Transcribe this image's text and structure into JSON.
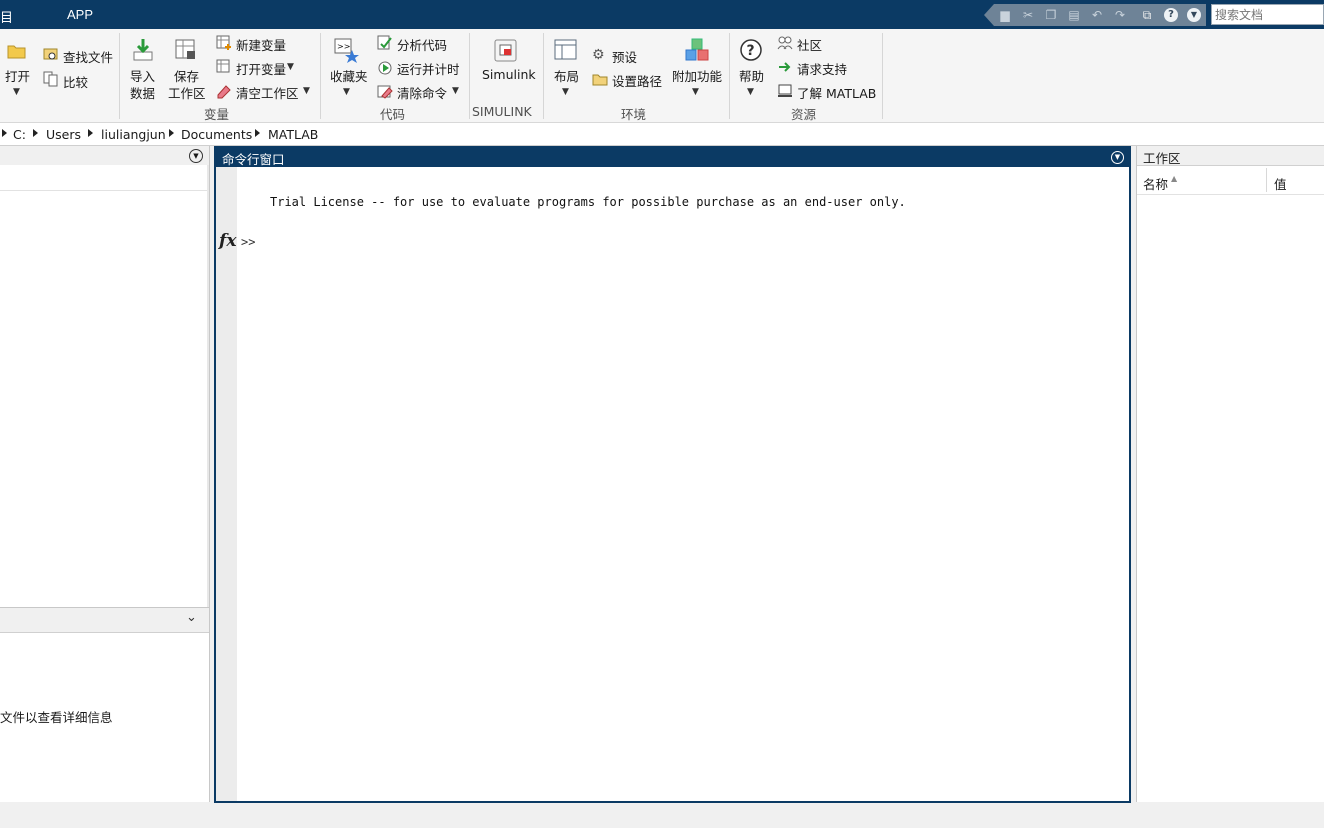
{
  "titlebar": {
    "left_glyph": "目",
    "tab_app": "APP",
    "search_placeholder": "搜索文档"
  },
  "ribbon": {
    "file": {
      "open_label": "打开",
      "find_files_label": "查找文件",
      "compare_label": "比较"
    },
    "variable": {
      "import_label_1": "导入",
      "import_label_2": "数据",
      "save_label_1": "保存",
      "save_label_2": "工作区",
      "new_variable": "新建变量",
      "open_variable": "打开变量",
      "clear_workspace": "清空工作区",
      "group_label": "变量"
    },
    "code": {
      "favorites_label": "收藏夹",
      "analyze_code": "分析代码",
      "run_and_time": "运行并计时",
      "clear_commands": "清除命令",
      "group_label": "代码"
    },
    "simulink": {
      "simulink_label": "Simulink",
      "group_label": "SIMULINK"
    },
    "environment": {
      "layout_label": "布局",
      "preferences": "预设",
      "set_path": "设置路径",
      "addons_label": "附加功能",
      "group_label": "环境"
    },
    "resources": {
      "help_label": "帮助",
      "community": "社区",
      "request_support": "请求支持",
      "learn_matlab": "了解 MATLAB",
      "group_label": "资源"
    }
  },
  "address": {
    "crumbs": [
      "C:",
      "Users",
      "liuliangjun",
      "Documents",
      "MATLAB"
    ]
  },
  "left_panel": {
    "details_text": "文件以查看详细信息"
  },
  "command_window": {
    "title": "命令行窗口",
    "license_text": "Trial License -- for use to evaluate programs for possible purchase as an end-user only.",
    "fx_label": "fx",
    "prompt": ">>"
  },
  "workspace": {
    "title": "工作区",
    "col_name": "名称",
    "col_value": "值"
  }
}
